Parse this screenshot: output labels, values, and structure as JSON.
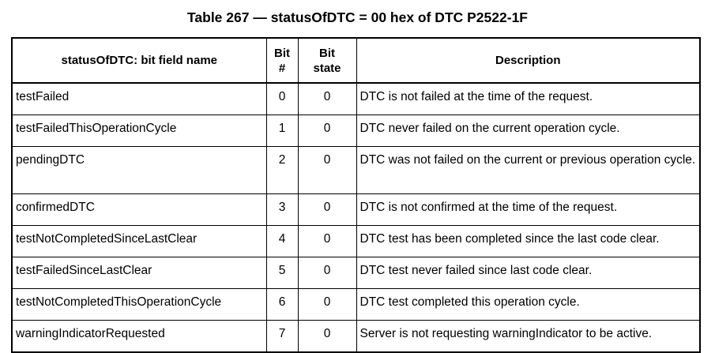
{
  "caption": "Table 267 — statusOfDTC = 00 hex of DTC P2522-1F",
  "columns": {
    "name": "statusOfDTC: bit field name",
    "bit_line1": "Bit",
    "bit_line2": "#",
    "state_line1": "Bit",
    "state_line2": "state",
    "description": "Description"
  },
  "rows": [
    {
      "name": "testFailed",
      "bit": "0",
      "state": "0",
      "description": "DTC is not failed at the time of the request."
    },
    {
      "name": "testFailedThisOperationCycle",
      "bit": "1",
      "state": "0",
      "description": "DTC never failed on the current operation cycle."
    },
    {
      "name": "pendingDTC",
      "bit": "2",
      "state": "0",
      "description": "DTC was not failed on the current or previous operation cycle."
    },
    {
      "name": "confirmedDTC",
      "bit": "3",
      "state": "0",
      "description": "DTC is not confirmed at the time of the request."
    },
    {
      "name": "testNotCompletedSinceLastClear",
      "bit": "4",
      "state": "0",
      "description": "DTC test has been completed since the last code clear."
    },
    {
      "name": "testFailedSinceLastClear",
      "bit": "5",
      "state": "0",
      "description": "DTC test never failed since last code clear."
    },
    {
      "name": "testNotCompletedThisOperationCycle",
      "bit": "6",
      "state": "0",
      "description": "DTC test completed this operation cycle."
    },
    {
      "name": "warningIndicatorRequested",
      "bit": "7",
      "state": "0",
      "description": "Server is not requesting warningIndicator to be active."
    }
  ]
}
